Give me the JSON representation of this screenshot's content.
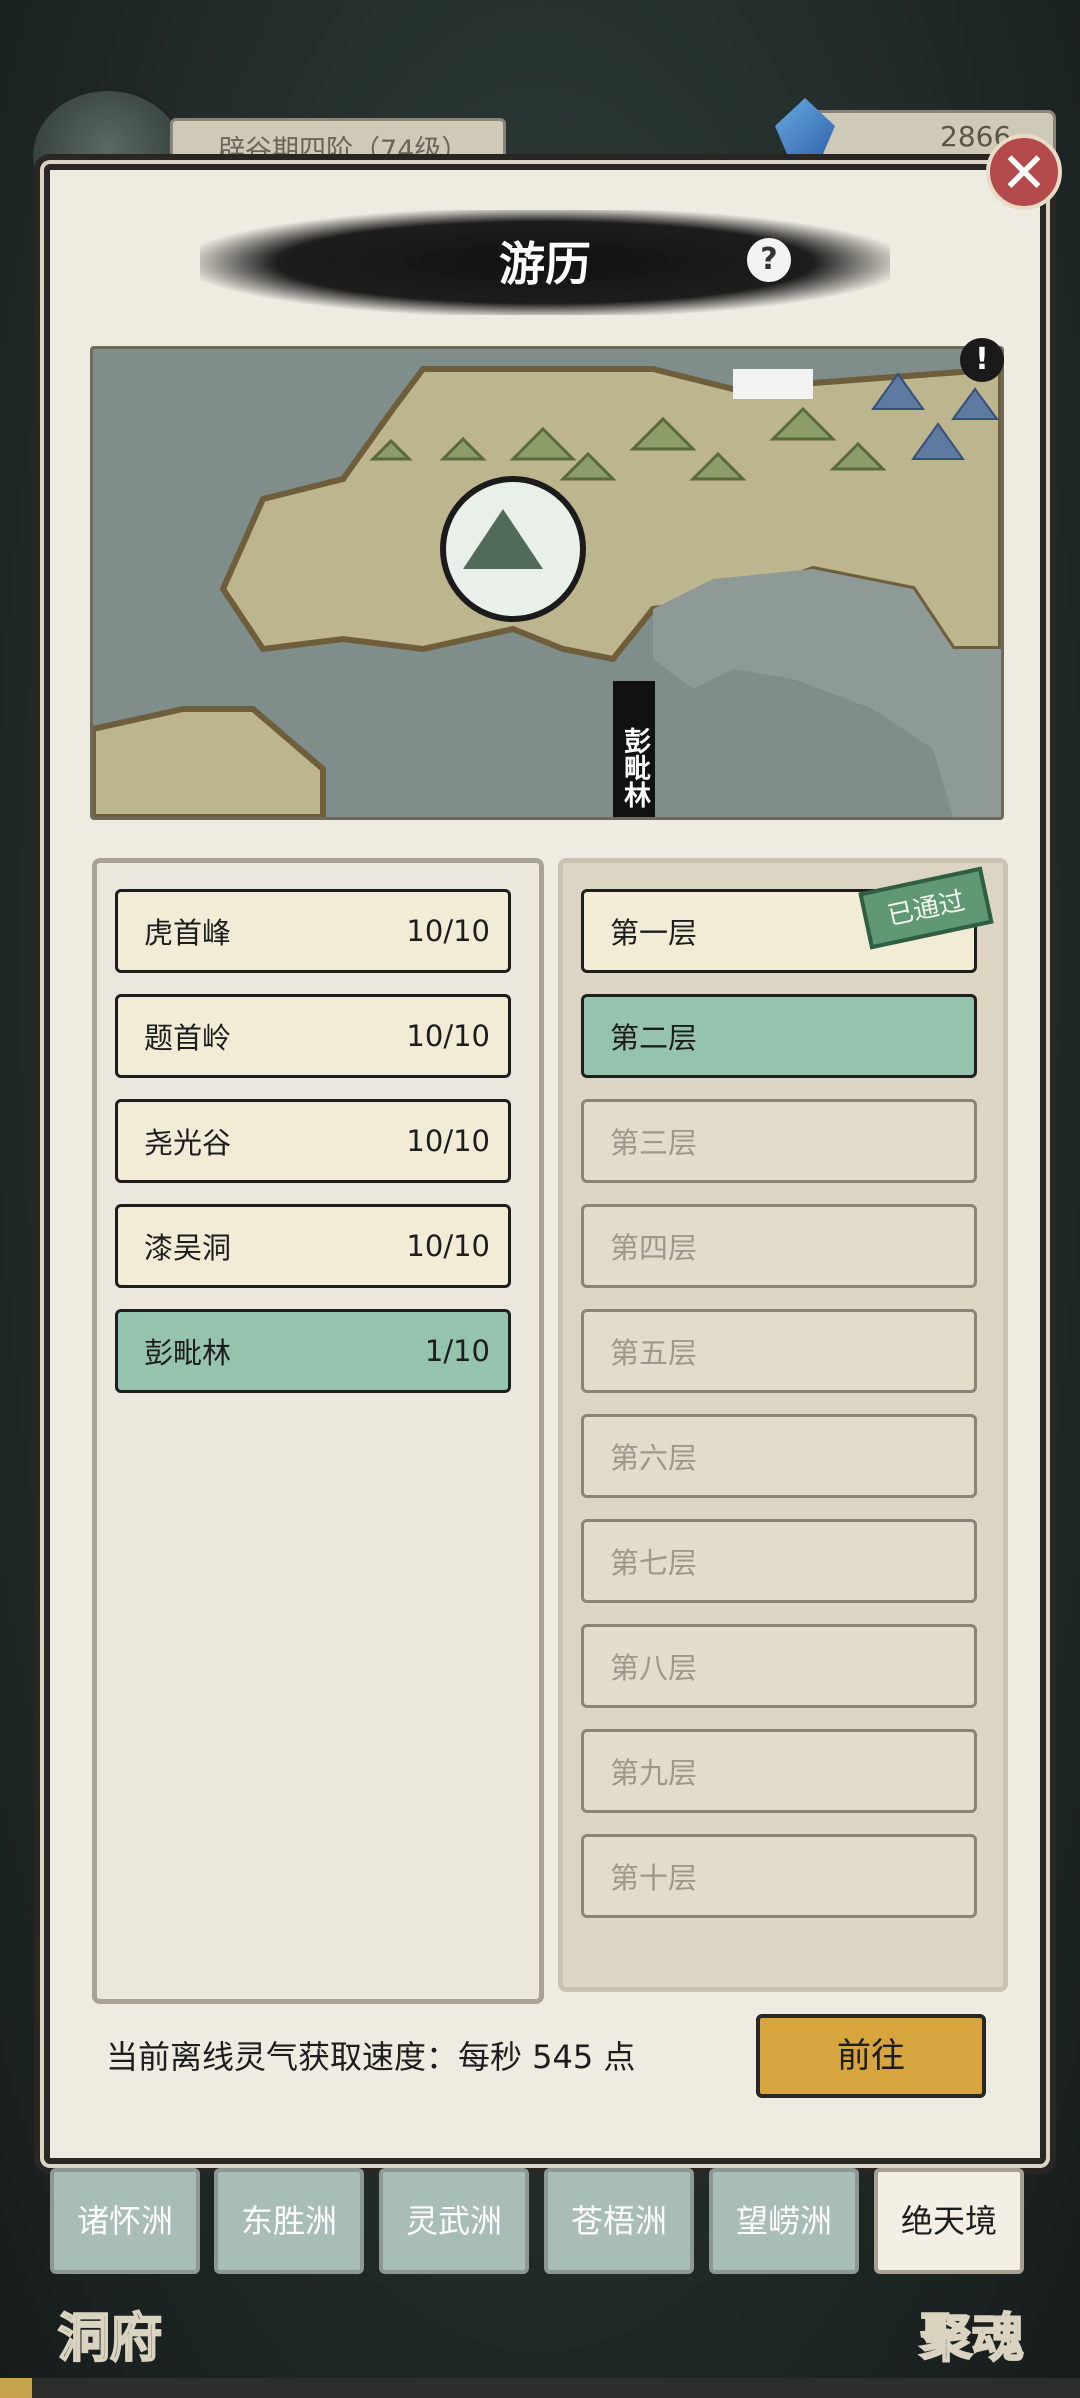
{
  "background": {
    "realm_label": "辟谷期四阶（74级）",
    "currency_value": "2866",
    "left_bottom_label": "洞府",
    "right_bottom_label": "聚魂",
    "progress_fraction": 0.03
  },
  "dialog": {
    "title": "游历",
    "help_icon": "?",
    "close_icon": "✕",
    "map_alert_icon": "!",
    "map_location_label": "彭毗林"
  },
  "areas": [
    {
      "name": "虎首峰",
      "progress": "10/10",
      "selected": false
    },
    {
      "name": "题首岭",
      "progress": "10/10",
      "selected": false
    },
    {
      "name": "尧光谷",
      "progress": "10/10",
      "selected": false
    },
    {
      "name": "漆吴洞",
      "progress": "10/10",
      "selected": false
    },
    {
      "name": "彭毗林",
      "progress": "1/10",
      "selected": true
    }
  ],
  "floors": [
    {
      "label": "第一层",
      "state": "cleared"
    },
    {
      "label": "第二层",
      "state": "selected"
    },
    {
      "label": "第三层",
      "state": "locked"
    },
    {
      "label": "第四层",
      "state": "locked"
    },
    {
      "label": "第五层",
      "state": "locked"
    },
    {
      "label": "第六层",
      "state": "locked"
    },
    {
      "label": "第七层",
      "state": "locked"
    },
    {
      "label": "第八层",
      "state": "locked"
    },
    {
      "label": "第九层",
      "state": "locked"
    },
    {
      "label": "第十层",
      "state": "locked"
    }
  ],
  "passed_badge": "已通过",
  "footer": {
    "status_text": "当前离线灵气获取速度：每秒 545 点",
    "go_button": "前往"
  },
  "continents": [
    {
      "label": "诸怀洲",
      "active": false
    },
    {
      "label": "东胜洲",
      "active": false
    },
    {
      "label": "灵武洲",
      "active": false
    },
    {
      "label": "苍梧洲",
      "active": false
    },
    {
      "label": "望崂洲",
      "active": false
    },
    {
      "label": "绝天境",
      "active": true
    }
  ],
  "colors": {
    "selected_green": "#96c3ad",
    "go_button_gold": "#d6a53e",
    "close_red": "#b54a4c"
  }
}
